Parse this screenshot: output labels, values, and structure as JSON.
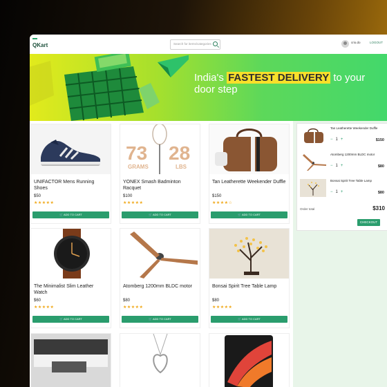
{
  "header": {
    "logo": "QKart",
    "search_placeholder": "Search for items/categories",
    "username": "crio.do",
    "logout_label": "LOGOUT"
  },
  "hero": {
    "text_before": "India's ",
    "highlight": "FASTEST DELIVERY",
    "text_after": " to your door step"
  },
  "products": [
    {
      "name": "UNIFACTOR Mens Running Shoes",
      "price": "$50",
      "rating": 5,
      "stars": "★★★★★",
      "add_label": "ADD TO CART"
    },
    {
      "name": "YONEX Smash Badminton Racquet",
      "price": "$100",
      "rating": 5,
      "stars": "★★★★★",
      "add_label": "ADD TO CART"
    },
    {
      "name": "Tan Leatherette Weekender Duffle",
      "price": "$150",
      "rating": 4,
      "stars": "★★★★☆",
      "add_label": "ADD TO CART"
    },
    {
      "name": "The Minimalist Slim Leather Watch",
      "price": "$60",
      "rating": 5,
      "stars": "★★★★★",
      "add_label": "ADD TO CART"
    },
    {
      "name": "Atomberg 1200mm BLDC motor",
      "price": "$80",
      "rating": 5,
      "stars": "★★★★★",
      "add_label": "ADD TO CART"
    },
    {
      "name": "Bonsai Spirit Tree Table Lamp",
      "price": "$80",
      "rating": 5,
      "stars": "★★★★★",
      "add_label": "ADD TO CART"
    }
  ],
  "racquet_image_text": {
    "big1": "73",
    "small1": "GRAMS",
    "big2": "28",
    "small2": "LBS"
  },
  "cart": {
    "items": [
      {
        "name": "Tan Leatherette Weekender Duffle",
        "qty": "1",
        "cost": "$150"
      },
      {
        "name": "Atomberg 1200mm BLDC motor",
        "qty": "1",
        "cost": "$80"
      },
      {
        "name": "Bonsai Spirit Tree Table Lamp",
        "qty": "1",
        "cost": "$80"
      }
    ],
    "minus": "−",
    "plus": "+",
    "order_total_label": "Order total",
    "order_total": "$310",
    "checkout_label": "CHECKOUT"
  },
  "colors": {
    "accent": "#2a9d6d",
    "star": "#f0a818",
    "highlight": "#f8e02a"
  }
}
